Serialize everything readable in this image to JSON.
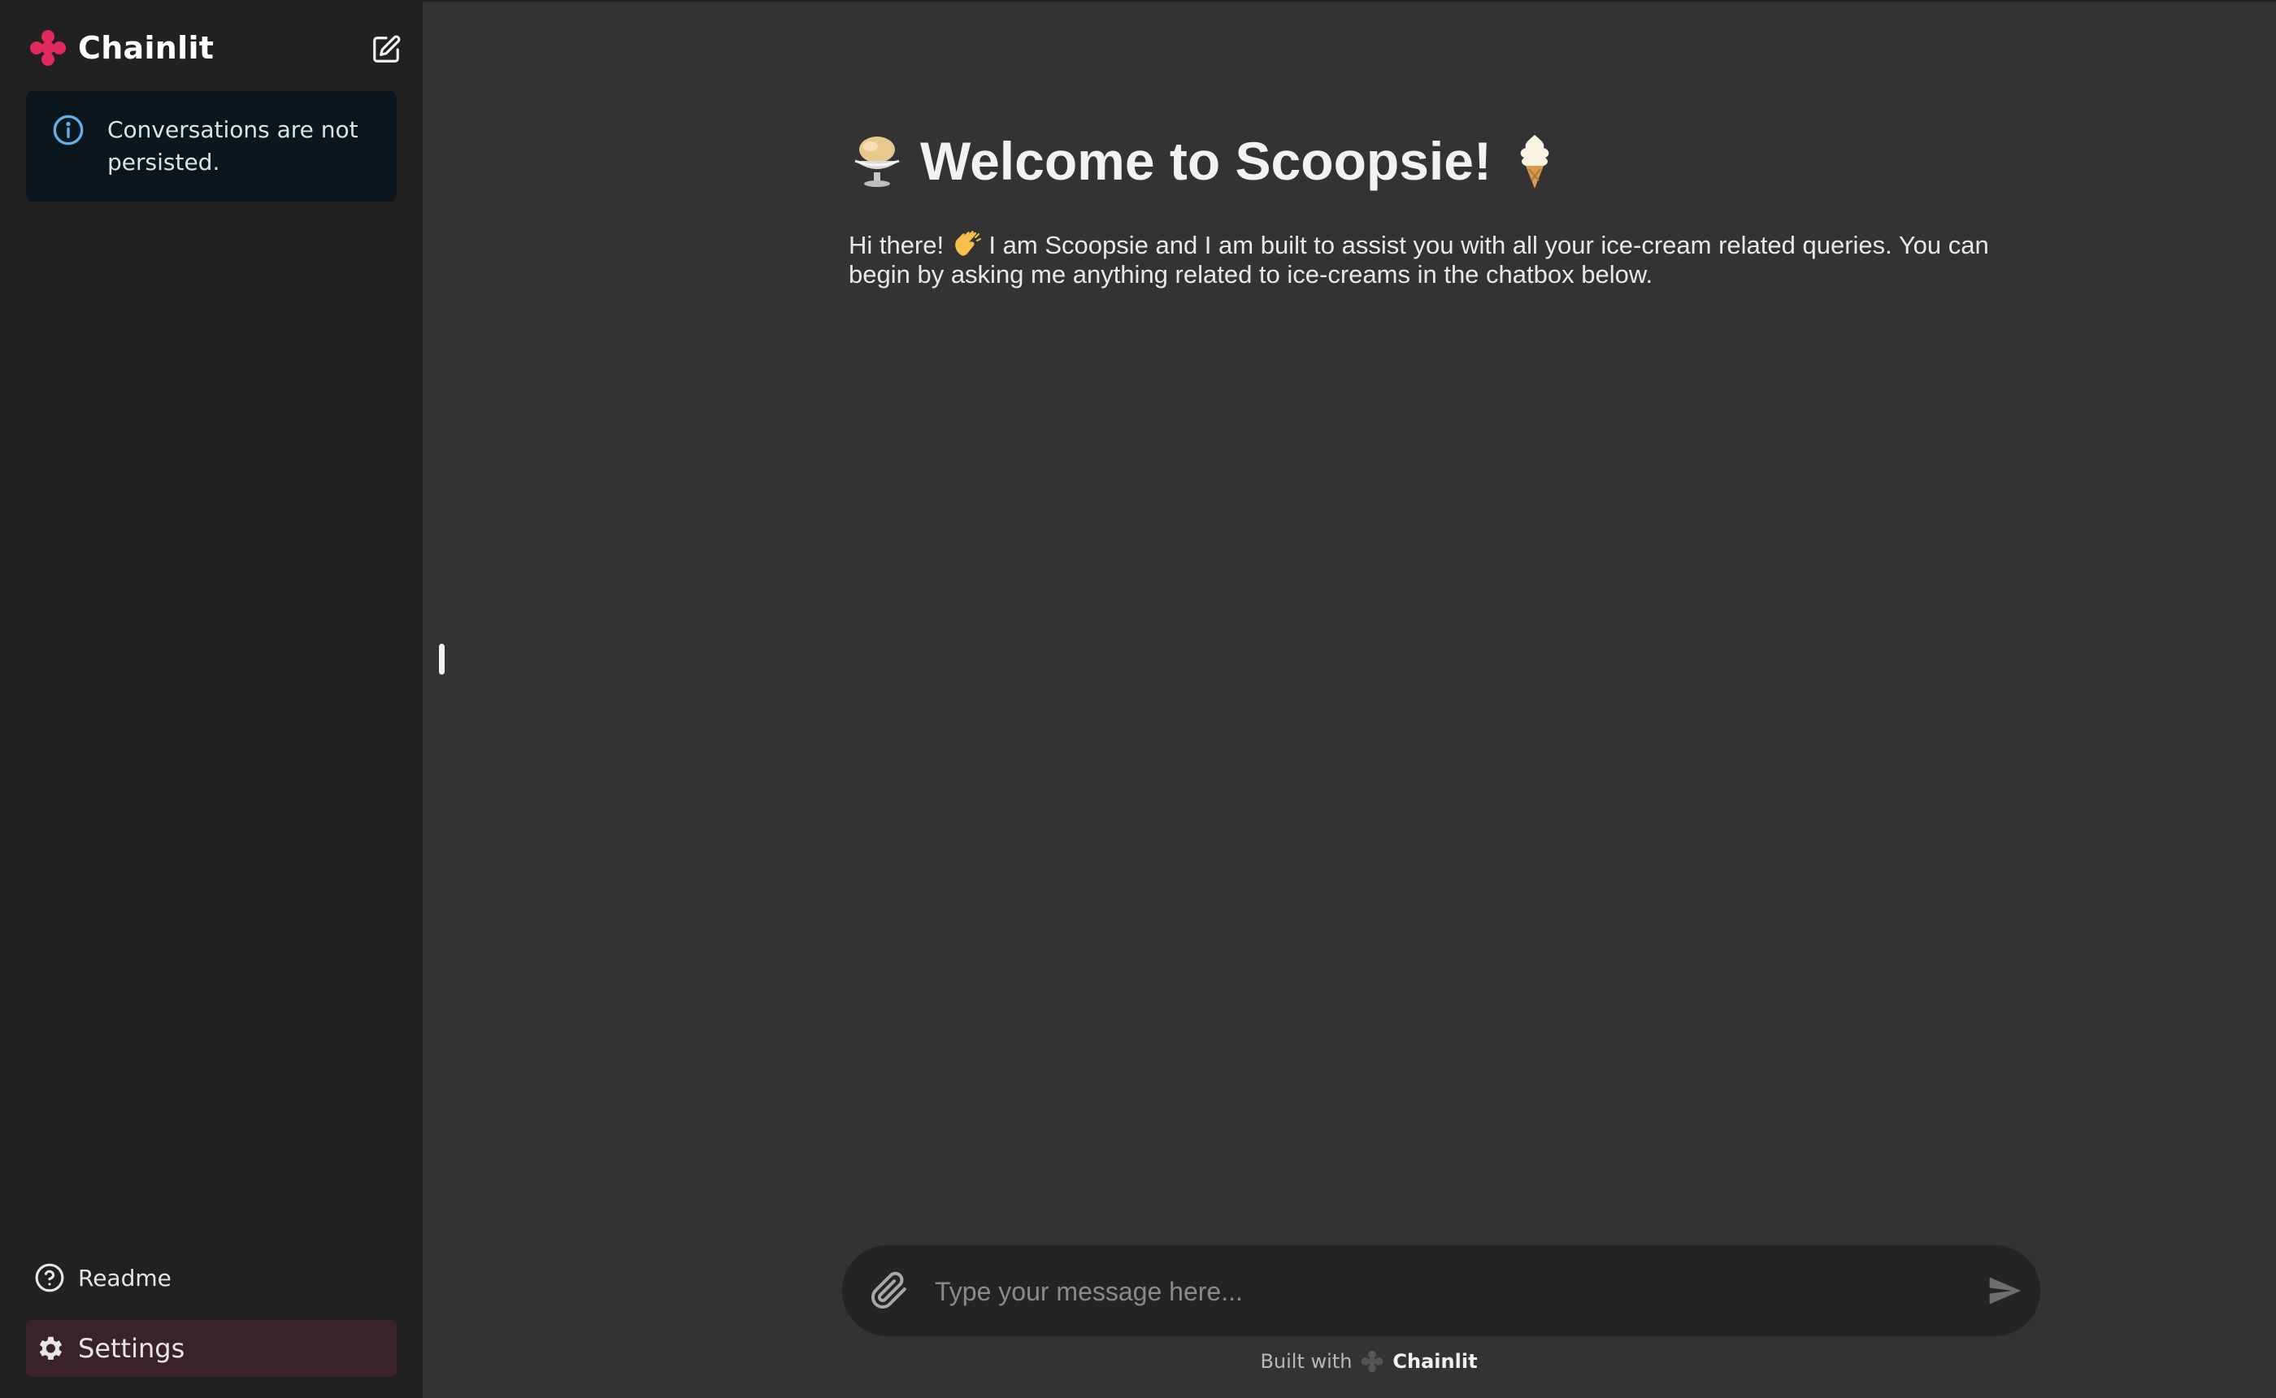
{
  "app": {
    "brand_name": "Chainlit",
    "accent_color": "#e3285e"
  },
  "sidebar": {
    "notice_text": "Conversations are not persisted.",
    "readme_label": "Readme",
    "settings_label": "Settings"
  },
  "main": {
    "welcome_title": "Welcome to Scoopsie!",
    "welcome_body_intro": "Hi there!",
    "welcome_body_rest": "I am Scoopsie and I am built to assist you with all your ice-cream related queries. You can begin by asking me anything related to ice-creams in the chatbox below."
  },
  "composer": {
    "placeholder": "Type your message here...",
    "value": ""
  },
  "footer": {
    "built_with": "Built with",
    "brand": "Chainlit"
  }
}
